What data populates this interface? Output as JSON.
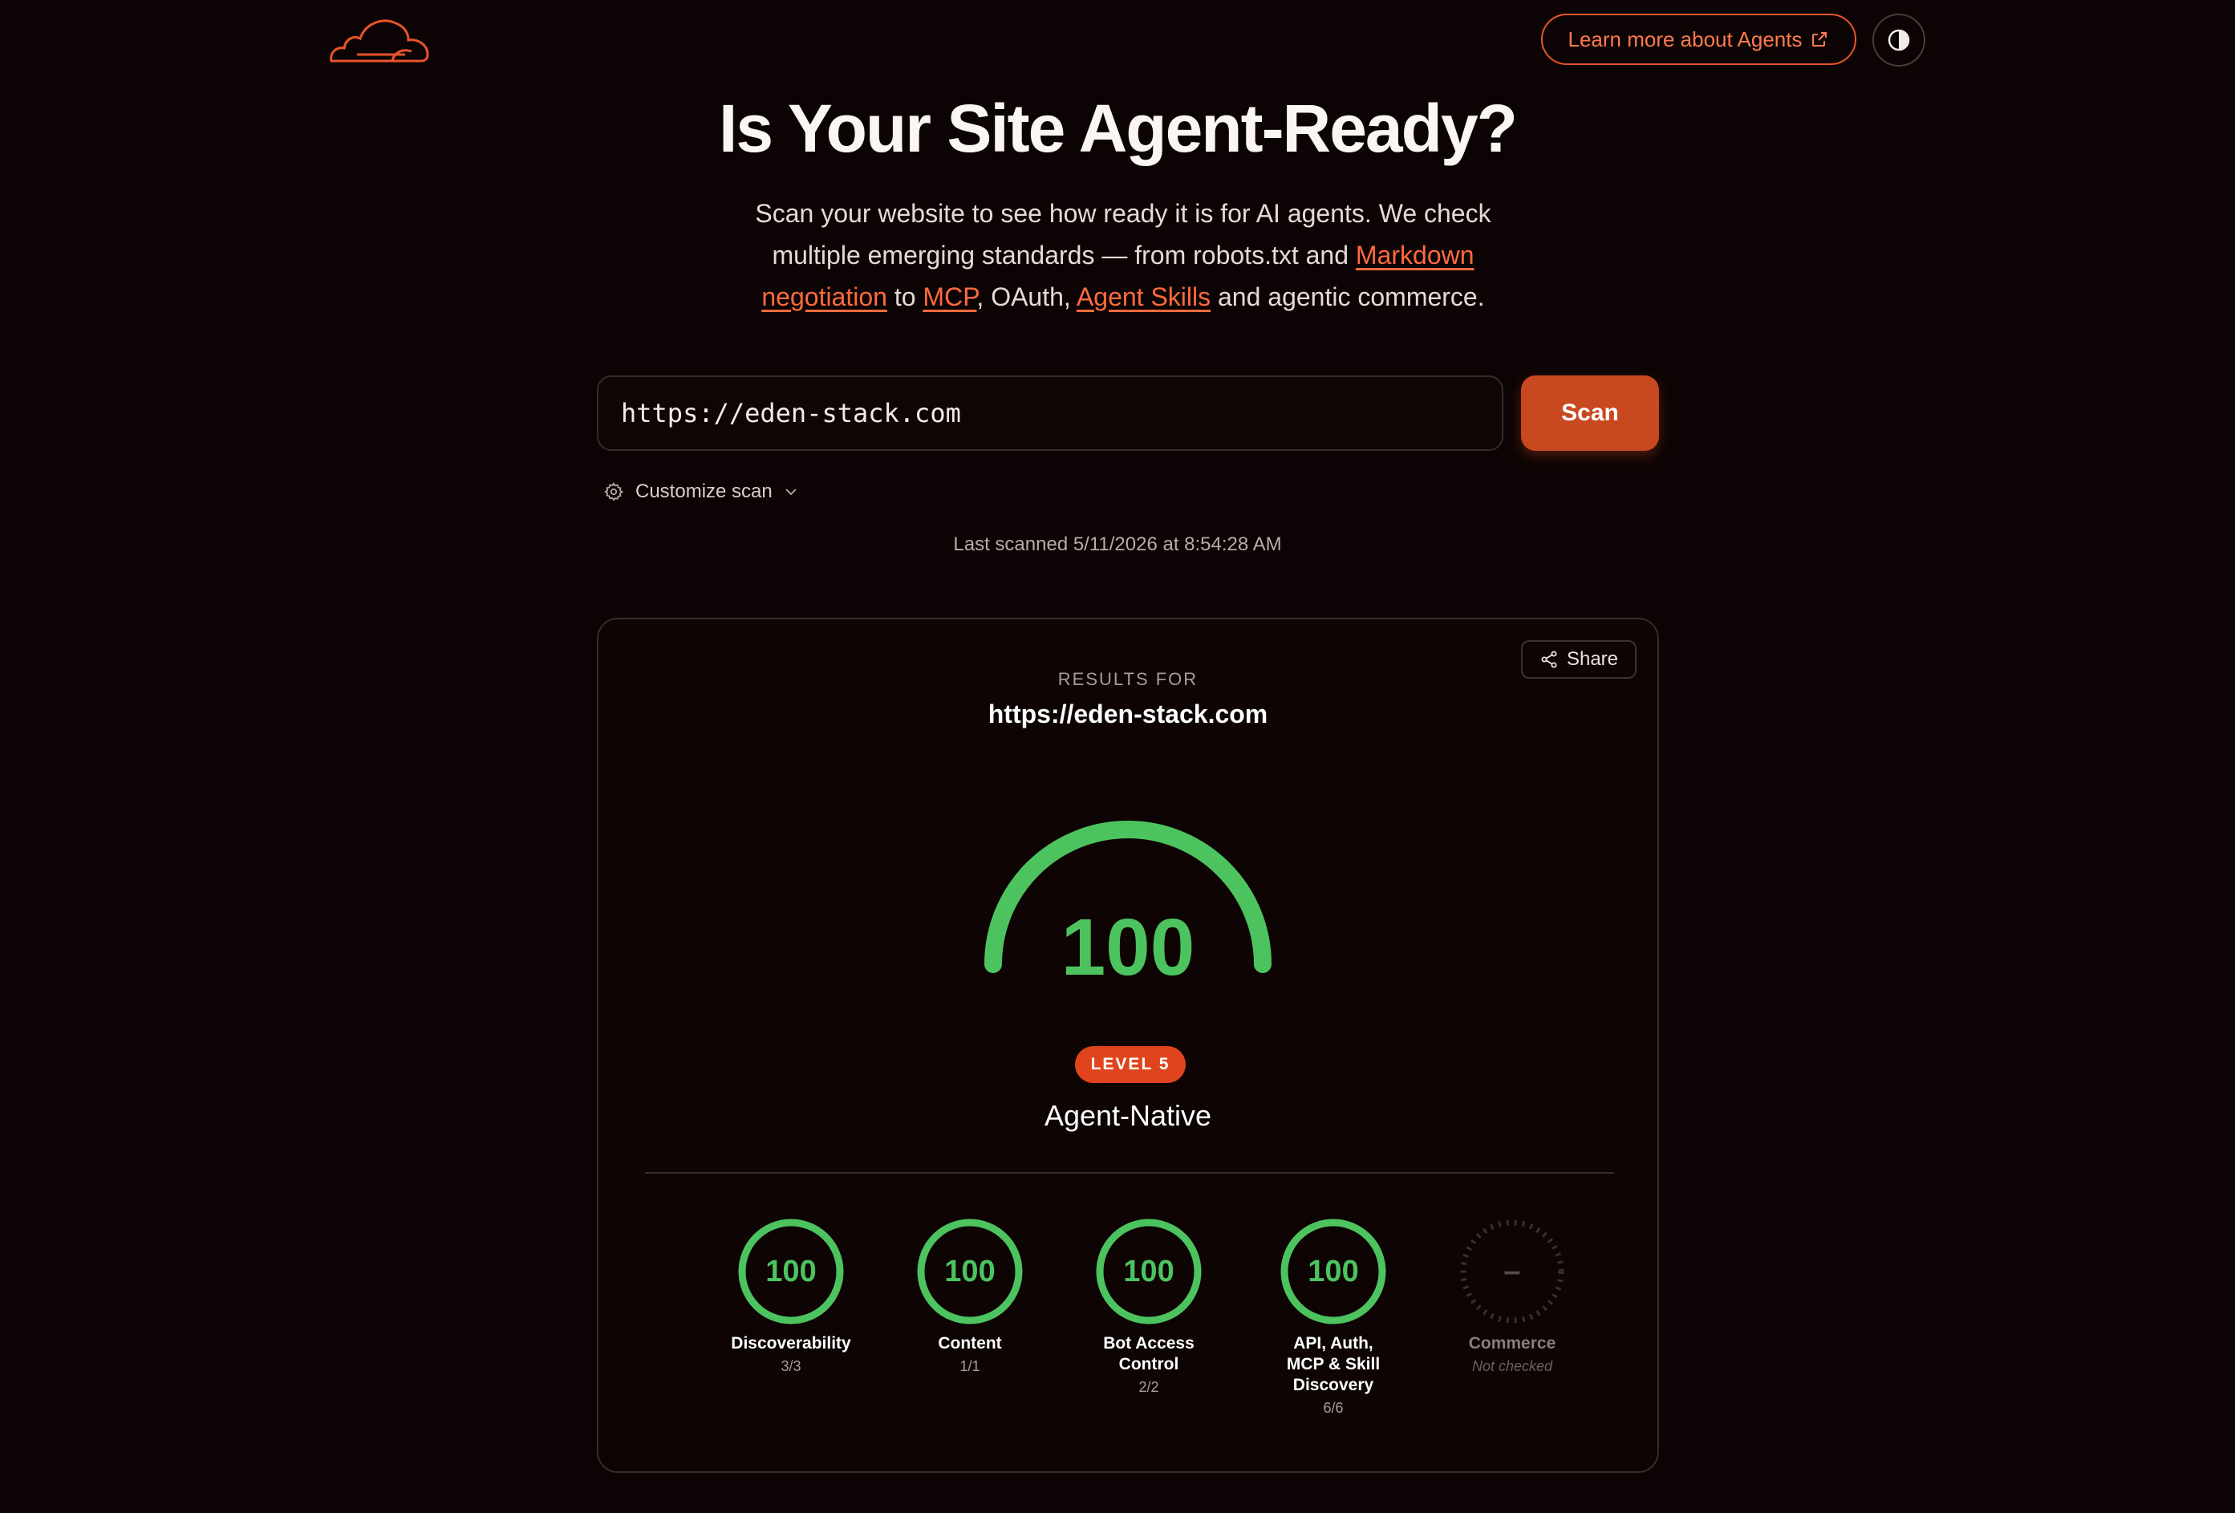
{
  "header": {
    "logo": "cloud-logo",
    "learn_more_label": "Learn more about Agents",
    "theme_toggle_icon": "contrast-icon"
  },
  "hero": {
    "title": "Is Your Site Agent-Ready?",
    "subtitle_part1": "Scan your website to see how ready it is for AI agents. We check multiple emerging standards — from robots.txt and ",
    "link_markdown": "Markdown negotiation",
    "subtitle_part2": " to ",
    "link_mcp": "MCP",
    "subtitle_part3": ", OAuth, ",
    "link_skills": "Agent Skills",
    "subtitle_part4": " and agentic commerce."
  },
  "scan": {
    "url_value": "https://eden-stack.com",
    "button_label": "Scan",
    "customize_label": "Customize scan",
    "last_scanned": "Last scanned 5/11/2026 at 8:54:28 AM"
  },
  "results": {
    "share_label": "Share",
    "results_for_label": "RESULTS FOR",
    "url": "https://eden-stack.com",
    "score": "100",
    "score_fraction": 1.0,
    "level_badge": "LEVEL 5",
    "level_name": "Agent-Native",
    "colors": {
      "accent": "#e0441c",
      "good": "#4cc35f"
    },
    "metrics": [
      {
        "score": "100",
        "label": "Discoverability",
        "sub": "3/3"
      },
      {
        "score": "100",
        "label": "Content",
        "sub": "1/1"
      },
      {
        "score": "100",
        "label": "Bot Access Control",
        "sub": "2/2"
      },
      {
        "score": "100",
        "label": "API, Auth, MCP & Skill Discovery",
        "sub": "6/6"
      },
      {
        "score": "–",
        "label": "Commerce",
        "sub": "Not checked"
      }
    ]
  }
}
